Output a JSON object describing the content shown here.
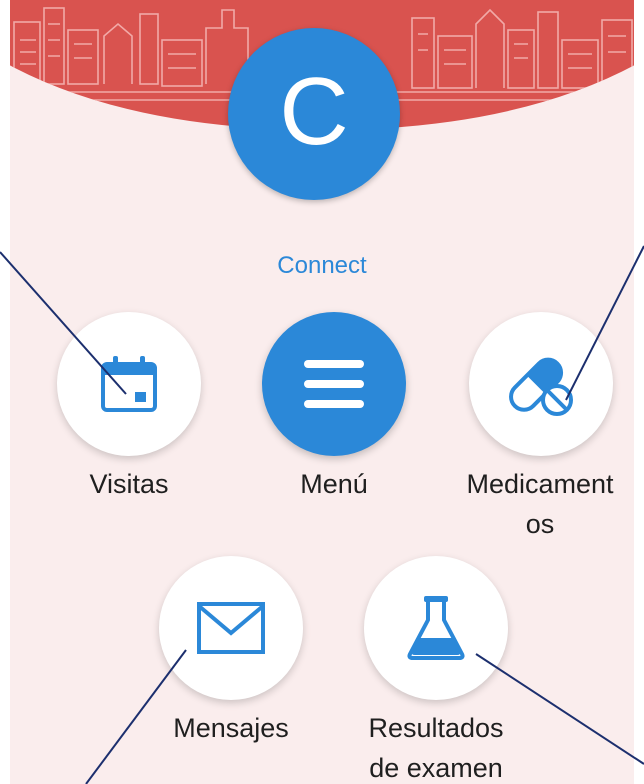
{
  "colors": {
    "accent": "#2b88d8",
    "banner": "#d9534f",
    "background": "#faeded",
    "tile": "#ffffff",
    "label": "#1f1f1f",
    "callout_line": "#1c2f6e"
  },
  "header": {
    "avatar_letter": "C",
    "brand_label": "Connect"
  },
  "menu": {
    "items": [
      {
        "label": "Visitas",
        "icon": "calendar-icon"
      },
      {
        "label": "Menú",
        "icon": "hamburger-menu-icon"
      },
      {
        "label": "Medicament\nos",
        "icon": "pills-icon"
      },
      {
        "label": "Mensajes",
        "icon": "envelope-icon"
      },
      {
        "label": "Resultados\nde examen",
        "icon": "flask-icon"
      }
    ]
  }
}
